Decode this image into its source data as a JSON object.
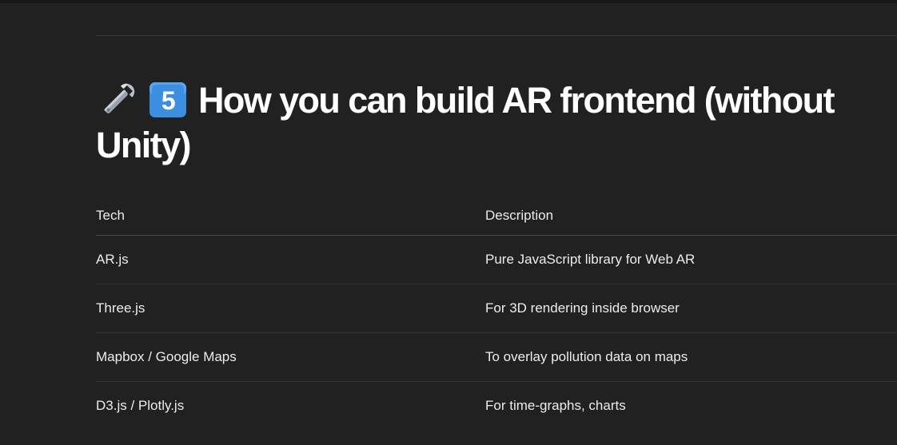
{
  "heading": {
    "icon_1": "wrench-icon",
    "icon_2": "keycap-five-icon",
    "keycap_digit": "5",
    "text": "How you can build AR frontend (without Unity)"
  },
  "table": {
    "columns": [
      "Tech",
      "Description"
    ],
    "rows": [
      {
        "tech": "AR.js",
        "description": "Pure JavaScript library for Web AR"
      },
      {
        "tech": "Three.js",
        "description": "For 3D rendering inside browser"
      },
      {
        "tech": "Mapbox / Google Maps",
        "description": "To overlay pollution data on maps"
      },
      {
        "tech": "D3.js / Plotly.js",
        "description": "For time-graphs, charts"
      }
    ]
  },
  "colors": {
    "background": "#212121",
    "text": "#ececec",
    "heading": "#ffffff",
    "keycap": "#3b8ee0",
    "wrench": "#b9c2cc"
  }
}
